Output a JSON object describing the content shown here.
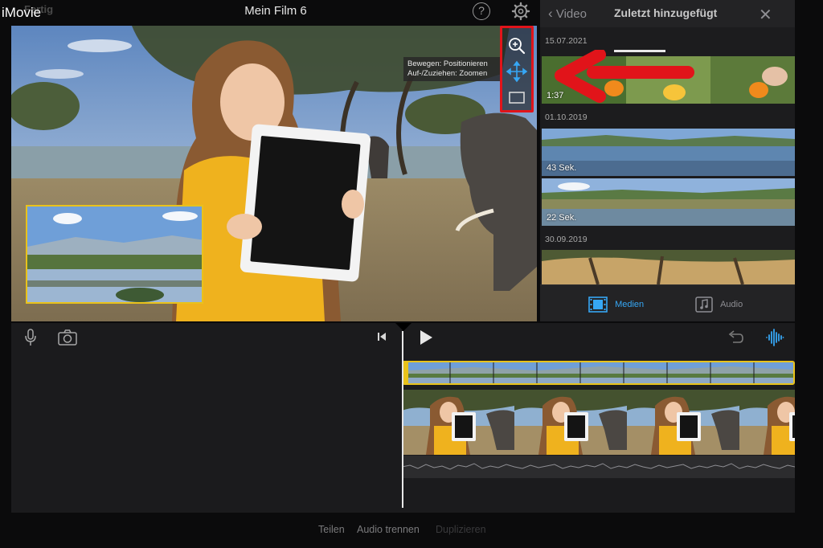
{
  "header": {
    "app_label": "iMovie",
    "done_label": "Fertig",
    "title": "Mein Film 6",
    "help_symbol": "?"
  },
  "viewer": {
    "tooltip_line1": "Bewegen: Positionieren",
    "tooltip_line2": "Auf-/Zuziehen: Zoomen",
    "tools": [
      "zoom-icon",
      "move-arrows-icon",
      "frame-icon"
    ]
  },
  "library": {
    "back_label": "Video",
    "title": "Zuletzt hinzugefügt",
    "close_symbol": "✕",
    "groups": [
      {
        "date": "15.07.2021",
        "clips": [
          {
            "duration": "1:37"
          }
        ]
      },
      {
        "date": "01.10.2019",
        "clips": [
          {
            "duration": "43 Sek."
          },
          {
            "duration": "22 Sek."
          }
        ]
      },
      {
        "date": "30.09.2019",
        "clips": [
          {
            "duration": ""
          }
        ]
      }
    ],
    "tabs": [
      {
        "label": "Medien",
        "active": true
      },
      {
        "label": "Audio",
        "active": false
      }
    ]
  },
  "timeline": {
    "controls": [
      "microphone-icon",
      "camera-icon",
      "skip-back-icon",
      "play-icon",
      "undo-icon",
      "waveform-icon"
    ]
  },
  "bottom_actions": [
    {
      "label": "Teilen",
      "enabled": true
    },
    {
      "label": "Audio trennen",
      "enabled": true
    },
    {
      "label": "Duplizieren",
      "enabled": false
    }
  ],
  "colors": {
    "accent": "#1e88e5",
    "selection": "#e9c21b",
    "annotation": "#e1141a",
    "background": "#0b0b0c"
  }
}
